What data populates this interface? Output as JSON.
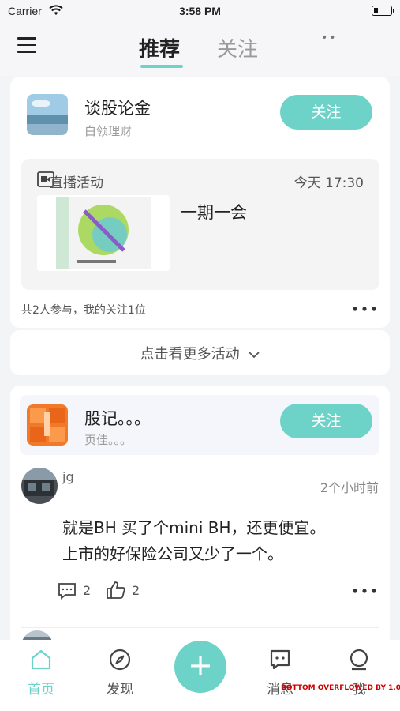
{
  "status_bar": {
    "carrier": "Carrier",
    "time": "3:58 PM"
  },
  "header": {
    "tabs": [
      {
        "label": "推荐",
        "active": true
      },
      {
        "label": "关注",
        "active": false
      }
    ],
    "dots": "••"
  },
  "feed": [
    {
      "type": "activity",
      "user": {
        "name": "谈股论金",
        "subtitle": "白领理财"
      },
      "follow_label": "关注",
      "activity": {
        "label": "直播活动",
        "time": "今天 17:30",
        "title": "一期一会"
      },
      "participants": "共2人参与，我的关注1位",
      "more_activities": "点击看更多活动"
    },
    {
      "type": "post",
      "group": {
        "name": "股记。。。",
        "subtitle": "页佳。。。"
      },
      "follow_label": "关注",
      "author": {
        "name": "jg",
        "time": "2个小时前"
      },
      "text_lines": [
        "就是BH 买了个mini BH，还更便宜。",
        "上市的好保险公司又少了一个。"
      ],
      "comments": "2",
      "likes": "2"
    }
  ],
  "bottom_nav": {
    "items": [
      {
        "label": "首页",
        "icon": "home-icon",
        "active": true
      },
      {
        "label": "发现",
        "icon": "compass-icon",
        "active": false
      },
      {
        "label": "消息",
        "icon": "message-icon",
        "active": false
      },
      {
        "label": "我",
        "icon": "profile-icon",
        "active": false
      }
    ],
    "plus": "+"
  },
  "overflow_banner": "BOTTOM OVERFLOWED BY 1.0",
  "colors": {
    "accent": "#6dd3c8",
    "background": "#f3f4f6"
  }
}
